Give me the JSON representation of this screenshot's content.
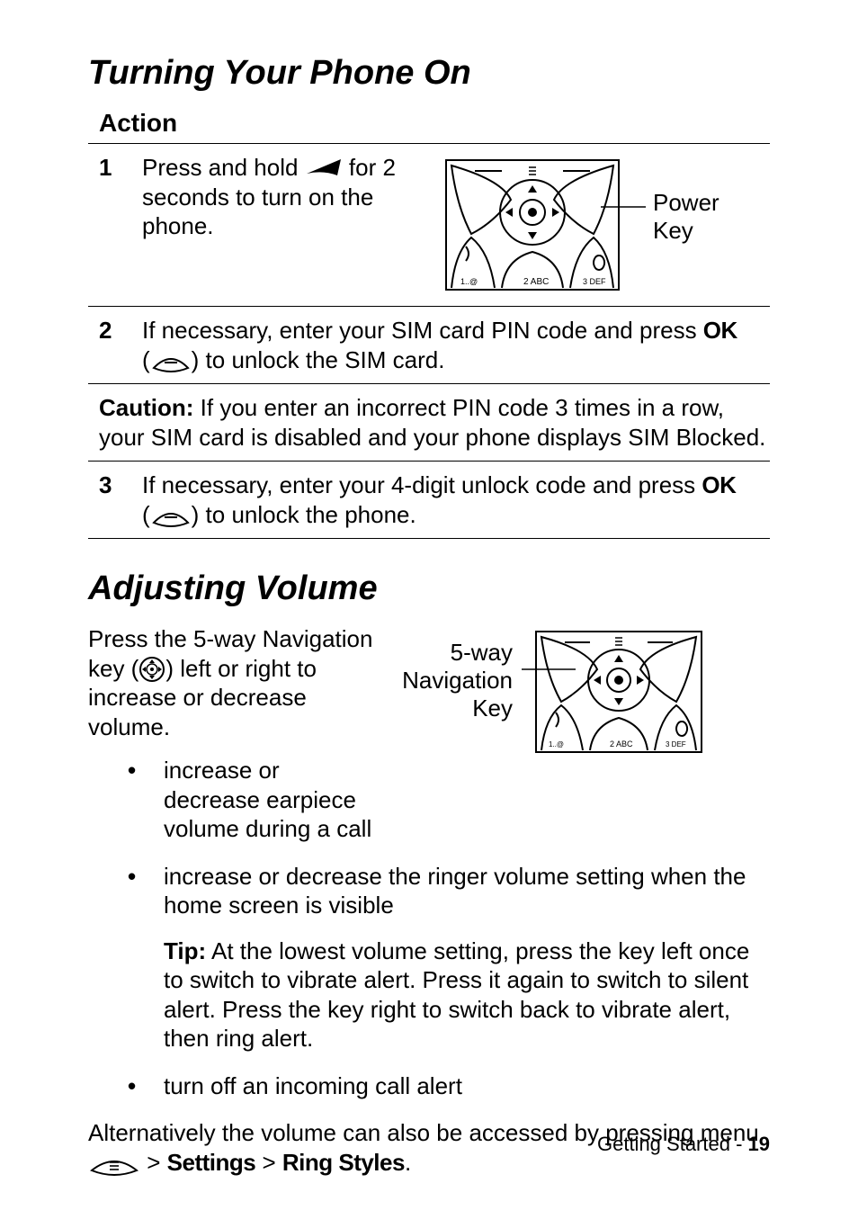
{
  "h1a": "Turning Your Phone On",
  "action_label": "Action",
  "step1": {
    "num": "1",
    "pre": "Press and hold ",
    "post": " for 2 seconds to turn on the phone."
  },
  "power_key_label_l1": "Power",
  "power_key_label_l2": "Key",
  "step2": {
    "num": "2",
    "pre": "If necessary, enter your SIM card PIN code and press ",
    "ok": "OK",
    "paren_pre": "(",
    "paren_post": ") to unlock the SIM card."
  },
  "caution": {
    "label": "Caution:",
    "text": " If you enter an incorrect PIN code 3 times in a row, your SIM card is disabled and your phone displays ",
    "tail": "SIM Blocked",
    "period": "."
  },
  "step3": {
    "num": "3",
    "pre": "If necessary, enter your 4-digit unlock code and press ",
    "ok": "OK",
    "paren_pre": "(",
    "paren_post": ") to unlock the phone."
  },
  "h1b": "Adjusting Volume",
  "adj_intro_pre": "Press the 5-way Navigation key (",
  "adj_intro_post": ") left or right to increase or decrease volume.",
  "nav_label_l1": "5-way",
  "nav_label_l2": "Navigation",
  "nav_label_l3": "Key",
  "bullets": {
    "b1": "increase or decrease earpiece volume during a call",
    "b2": "increase or decrease the ringer volume setting when the home screen is visible",
    "tip_label": "Tip:",
    "tip_text": " At the lowest volume setting, press the key left once to switch to vibrate alert. Press it again to switch to silent alert. Press the key right to switch back to vibrate alert, then ring alert.",
    "b3": "turn off an incoming call alert"
  },
  "alt_pre": "Alternatively the volume can also be accessed by pressing menu ",
  "alt_gt1": " > ",
  "alt_settings": "Settings",
  "alt_gt2": " > ",
  "alt_ring": "Ring Styles",
  "alt_period": ".",
  "footer_section": "Getting Started - ",
  "footer_page": "19"
}
